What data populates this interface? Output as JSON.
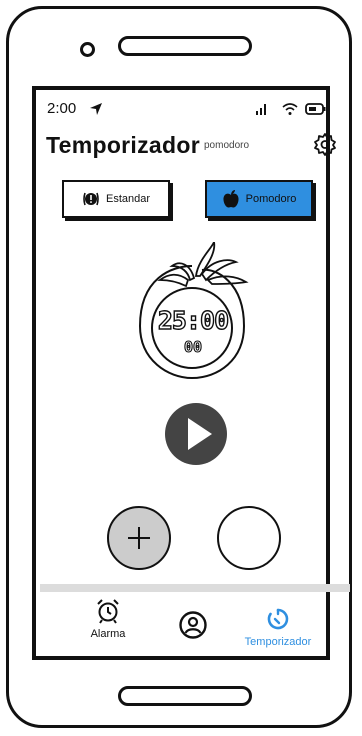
{
  "status": {
    "time": "2:00"
  },
  "header": {
    "title": "Temporizador",
    "subtitle": "pomodoro"
  },
  "modes": {
    "standard_label": "Estandar",
    "pomodoro_label": "Pomodoro"
  },
  "timer": {
    "display": "25:00",
    "subdisplay": "00"
  },
  "nav": {
    "items": [
      {
        "label": "Alarma"
      },
      {
        "label": ""
      },
      {
        "label": "Temporizador"
      }
    ]
  },
  "colors": {
    "accent": "#2f8fe0",
    "play": "#444444",
    "add_fill": "#cccccc"
  }
}
